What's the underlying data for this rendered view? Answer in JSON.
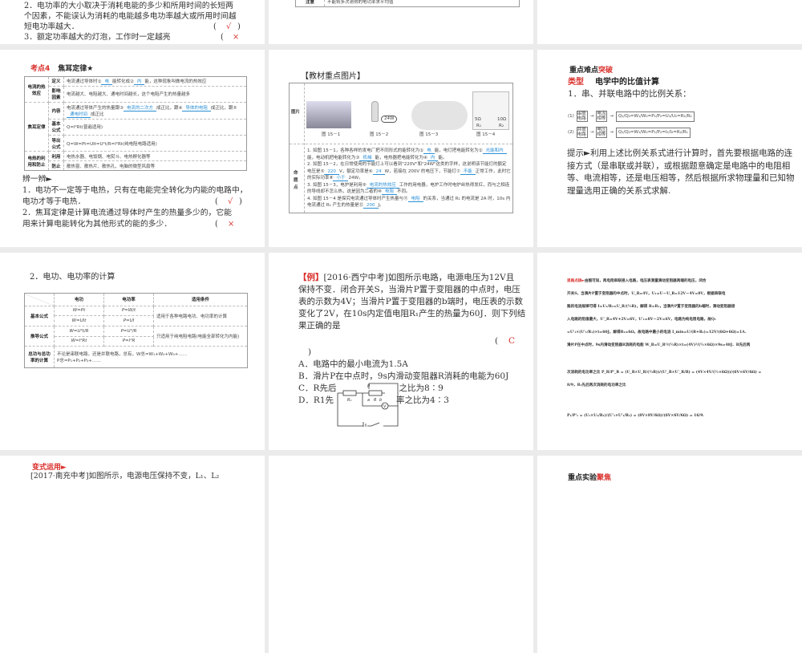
{
  "r1c1": {
    "lines": [
      "2．电功率的大小取决于消耗电能的多少和所用时间的长短两",
      "个因素，不能误认为消耗的电能越多电功率越大或所用时间越",
      "短电功率越大．",
      "3．额定功率越大的灯泡，工作时一定越亮"
    ],
    "paren": "(",
    "close": ")",
    "check": "√",
    "cross": "×"
  },
  "r1c2": {
    "row_head": "注意",
    "row_text": "不能将多次测得的电功率求平均值"
  },
  "kd4": {
    "tag": "考点4",
    "title": "焦耳定律★",
    "rows": [
      {
        "group": "电流的热效应",
        "k": "定义",
        "v1": "电流通过导体时①",
        "f1": "电",
        "v2": "能转化成②",
        "f2": "内",
        "v3": "能，这种现象叫做电流的热效应"
      },
      {
        "k": "影响因素",
        "v": "电流越大、电阻越大、通电时间越长，这个电阻产生的热量越多"
      },
      {
        "group": "焦耳定律",
        "k": "内容",
        "v1": "电流通过导体产生的热量跟③",
        "f1": "电流的二次方",
        "v2": "成正比，跟④",
        "f2": "导体的电阻",
        "v3": "成正比，跟⑤",
        "f3": "通电时间",
        "v4": "成正比"
      },
      {
        "k": "基本公式",
        "v": "Q=I²Rt(普遍适用)"
      },
      {
        "k": "导出公式",
        "v": "Q=W=Pt=UIt=U²t/R=I²Rt(纯电阻电路适用)"
      },
      {
        "group": "电热的利用和防止",
        "k": "利用",
        "v": "电热水器、电饭锅、电熨斗、电热孵化器等"
      },
      {
        "k": "防止",
        "v": "散热窗、散热片、散热孔、电脑的微型风扇等"
      }
    ],
    "bianyibian": "辨一辨►",
    "q1": [
      "1．电功不一定等于电热，只有在电能完全转化为内能的电路中，",
      "电功才等于电热．"
    ],
    "q2": [
      "2．焦耳定律是计算电流通过导体时产生的热量多少的，它能",
      "用来计算电能转化为其他形式的能的多少．"
    ],
    "check": "√",
    "cross": "×",
    "paren": "(",
    "close": ")"
  },
  "jc": {
    "title": "【教材重点图片】",
    "row1": "图片",
    "row2": "命题点",
    "captions": [
      "图 15－1",
      "图 15－2",
      "图 15－3",
      "图 15－4"
    ],
    "bulb_label": "24W",
    "r_labels": [
      "5Ω",
      "10Ω"
    ],
    "r_names": [
      "R₁",
      "R₂"
    ],
    "p1a": "1. 如图 15－1，各种各样的发电厂把不同形式的能转化为①",
    "f1": "电",
    "p1b": "能，电灯把电能转化为",
    "p1c": "②",
    "f2": "光能和内",
    "p1d": "能，电动机把电能转化为③",
    "f3": "机械",
    "p1e": "能，电热器把电能转化为④",
    "f4": "内",
    "p1f": "能。",
    "p2a": "2. 如图 15－2，在日常使用的节能灯上可以看到\"220V\"和\"24W\"这类的字样，这说明该节能灯的额定电压是⑤",
    "f5": "220",
    "p2b": "V，额定功率是⑥",
    "f6": "24",
    "p2c": "W，若接在 200V 的电压下，节能灯⑦",
    "f7": "不能",
    "p2d": "正常工作，此时它的实际功率⑧",
    "f8": "小于",
    "p2e": "24W。",
    "p3a": "3. 如图 15－3，电炉是利用⑨",
    "f9": "电流的热效应",
    "p3b": "工作的用电器，电炉工作时电炉丝热得发红，而与之相连的导线却不怎么热，这是因为二者的⑩",
    "f10": "电阻",
    "p3c": "不同。",
    "p4a": "4. 如图 15－4 是探究电流通过导体时产生热量与⑪",
    "f11": "电阻",
    "p4b": "的关系，当通过 R₁ 的电流是 2A 时，10s 内电流通过 R₁ 产生的热量是⑫",
    "f12": "200",
    "p4c": "J。"
  },
  "zd": {
    "h1a": "重点难点",
    "h1b": "突破",
    "tag": "类型",
    "title": "电学中的比值计算",
    "sub": "1．串、并联电路中的比例关系：",
    "r1": {
      "n": "(1)",
      "a": "串联电路",
      "b": "电流相等",
      "f": "Q₁/Q₂=W₁/W₂=P₁/P₂=U₁/U₂=R₁/R₂"
    },
    "r2": {
      "n": "(2)",
      "a": "并联电路",
      "b": "电压相等",
      "f": "Q₁/Q₂=W₁/W₂=P₁/P₂=I₁/I₂=R₂/R₁"
    },
    "tip": [
      "提示►利用上述比例关系式进行计算时，首先要根据电路的连",
      "接方式（是串联或并联），或根据题意确定是电路中的电阻相",
      "等、电流相等，还是电压相等，然后根据所求物理量和已知物",
      "理量选用正确的关系式求解."
    ]
  },
  "dg": {
    "title": "2．电功、电功率的计算",
    "headers": [
      "电功",
      "电功率",
      "适用条件"
    ],
    "g1": "基本公式",
    "g1r": [
      [
        "W=Pt",
        "P=W/t"
      ],
      [
        "W=UIt",
        "P=UI"
      ]
    ],
    "g1c": "适用于各种电路电功、电功率的计算",
    "g2": "推导公式",
    "g2r": [
      [
        "W=U²t/R",
        "P=U²/R"
      ],
      [
        "W=I²Rt",
        "P=I²R"
      ]
    ],
    "g2c": "只适用于纯电阻电路(电能全部转化为内能)",
    "g3": "总功与总功率的计算",
    "g3a": "不论是串联电路，还是并联电路，总有，W总=W₁+W₂+W₃+……",
    "g3b": "P总=P₁+P₂+P₃+……"
  },
  "ex": {
    "tag": "【例】",
    "lines": [
      "[2016·西宁中考]如图所示电路，电源电压为12V且",
      "保持不变．闭合开关S，当滑片P置于变阻器的中点时，电压",
      "表的示数为4V；当滑片P置于变阻器的b端时，电压表的示数",
      "变化了2V，在10s内定值电阻R₁产生的热量为60J．则下列结",
      "果正确的是"
    ],
    "paren": "(",
    "answer": "C",
    "close": ")",
    "optA": "A．电路中的最小电流为1.5A",
    "optB": "B．滑片P在中点时，9s内滑动变阻器R消耗的电能为60J",
    "optC1": "C．R先后",
    "optC2": "之比为8∶9",
    "optD1": "D．R1先",
    "optD2": "率之比为4∶3",
    "circuit": {
      "r1": "R₁",
      "p": "P",
      "a": "a",
      "r": "R",
      "b": "b",
      "v": "V",
      "s": "S"
    }
  },
  "sl": {
    "tag": "思路点拨►",
    "lines": [
      "由图可知，两电阻串联接入电路，电压表测量滑动变阻器两端的电压，闭合",
      "开关S，当滑片P置于变阻器的中点时，U_R=4V，U₁=U－U_R=12V－4V=8V，根据串联电",
      "路的电流规律可得 I=U₁/R₁=U_R/(½R)，解得 R=R₁，当滑片P置于变阻器的b端时，滑动变阻器接",
      "入电路的阻值最大，U'_R=4V+2V=6V，U'₁=8V－2V=6V，电路为纯电阻电路，故Q₁",
      "=U'₁×(U'₁/R₁)×t=60J，解得R₁=6Ω，故电路中最小的电流 I_min=U/(R+R₁)=12V/(6Ω+6Ω)=1A．",
      "滑片P在中点时，9s内滑动变阻器R消耗的电能 W_R=U_R²/(½R)×t=(4V)²/(½×6Ω)×9s=48J．R先后两",
      "次消耗的电功率之比 P_R/P'_R = (U_R×U_R/(½R))/(U'_R×U'_R/R) = (4V×4V/(½×6Ω))/(6V×6V/6Ω) = 8/9，R₁先后两次消耗的电功率之比",
      "P₁/P'₁ = (U₁×U₁/R₁)/(U'₁×U'₁/R₁) = (8V×8V/6Ω)/(6V×6V/6Ω) = 16/9."
    ]
  },
  "bs": {
    "tag": "变式运用►",
    "line": "[2017·南充中考]如图所示，电源电压保持不变，L₁、L₂"
  },
  "sy": {
    "a": "重点实验",
    "b": "聚焦"
  }
}
